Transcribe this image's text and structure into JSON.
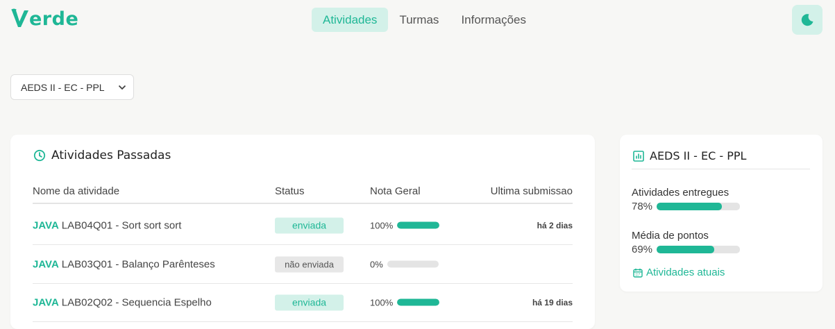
{
  "header": {
    "logo_text": "erde",
    "nav": [
      {
        "label": "Atividades",
        "active": true
      },
      {
        "label": "Turmas",
        "active": false
      },
      {
        "label": "Informações",
        "active": false
      }
    ],
    "theme_icon": "moon-icon"
  },
  "class_select": {
    "value": "AEDS II - EC - PPL",
    "icon": "chevron-down-icon"
  },
  "past_activities": {
    "title": "Atividades Passadas",
    "icon": "clock-icon",
    "columns": [
      "Nome da atividade",
      "Status",
      "Nota Geral",
      "Ultima submissao"
    ],
    "rows": [
      {
        "lang": "JAVA",
        "name": "LAB04Q01 - Sort sort sort",
        "status": "enviada",
        "grade": "100%",
        "grade_value": 1.0,
        "when": "há 2 dias"
      },
      {
        "lang": "JAVA",
        "name": "LAB03Q01 - Balanço Parênteses",
        "status": "não enviada",
        "grade": "0%",
        "grade_value": 0.0,
        "when": ""
      },
      {
        "lang": "JAVA",
        "name": "LAB02Q02 - Sequencia Espelho",
        "status": "enviada",
        "grade": "100%",
        "grade_value": 1.0,
        "when": "há 19 dias"
      }
    ]
  },
  "summary": {
    "title": "AEDS II - EC - PPL",
    "icon": "bar-chart-icon",
    "stats": [
      {
        "label": "Atividades entregues",
        "value": "78%",
        "fraction": 0.78
      },
      {
        "label": "Média de pontos",
        "value": "69%",
        "fraction": 0.69
      }
    ],
    "link_label": "Atividades atuais",
    "link_icon": "calendar-icon"
  },
  "colors": {
    "accent": "#1fb796",
    "accent_light": "#d3f1e9",
    "background": "#f7f7f5"
  }
}
